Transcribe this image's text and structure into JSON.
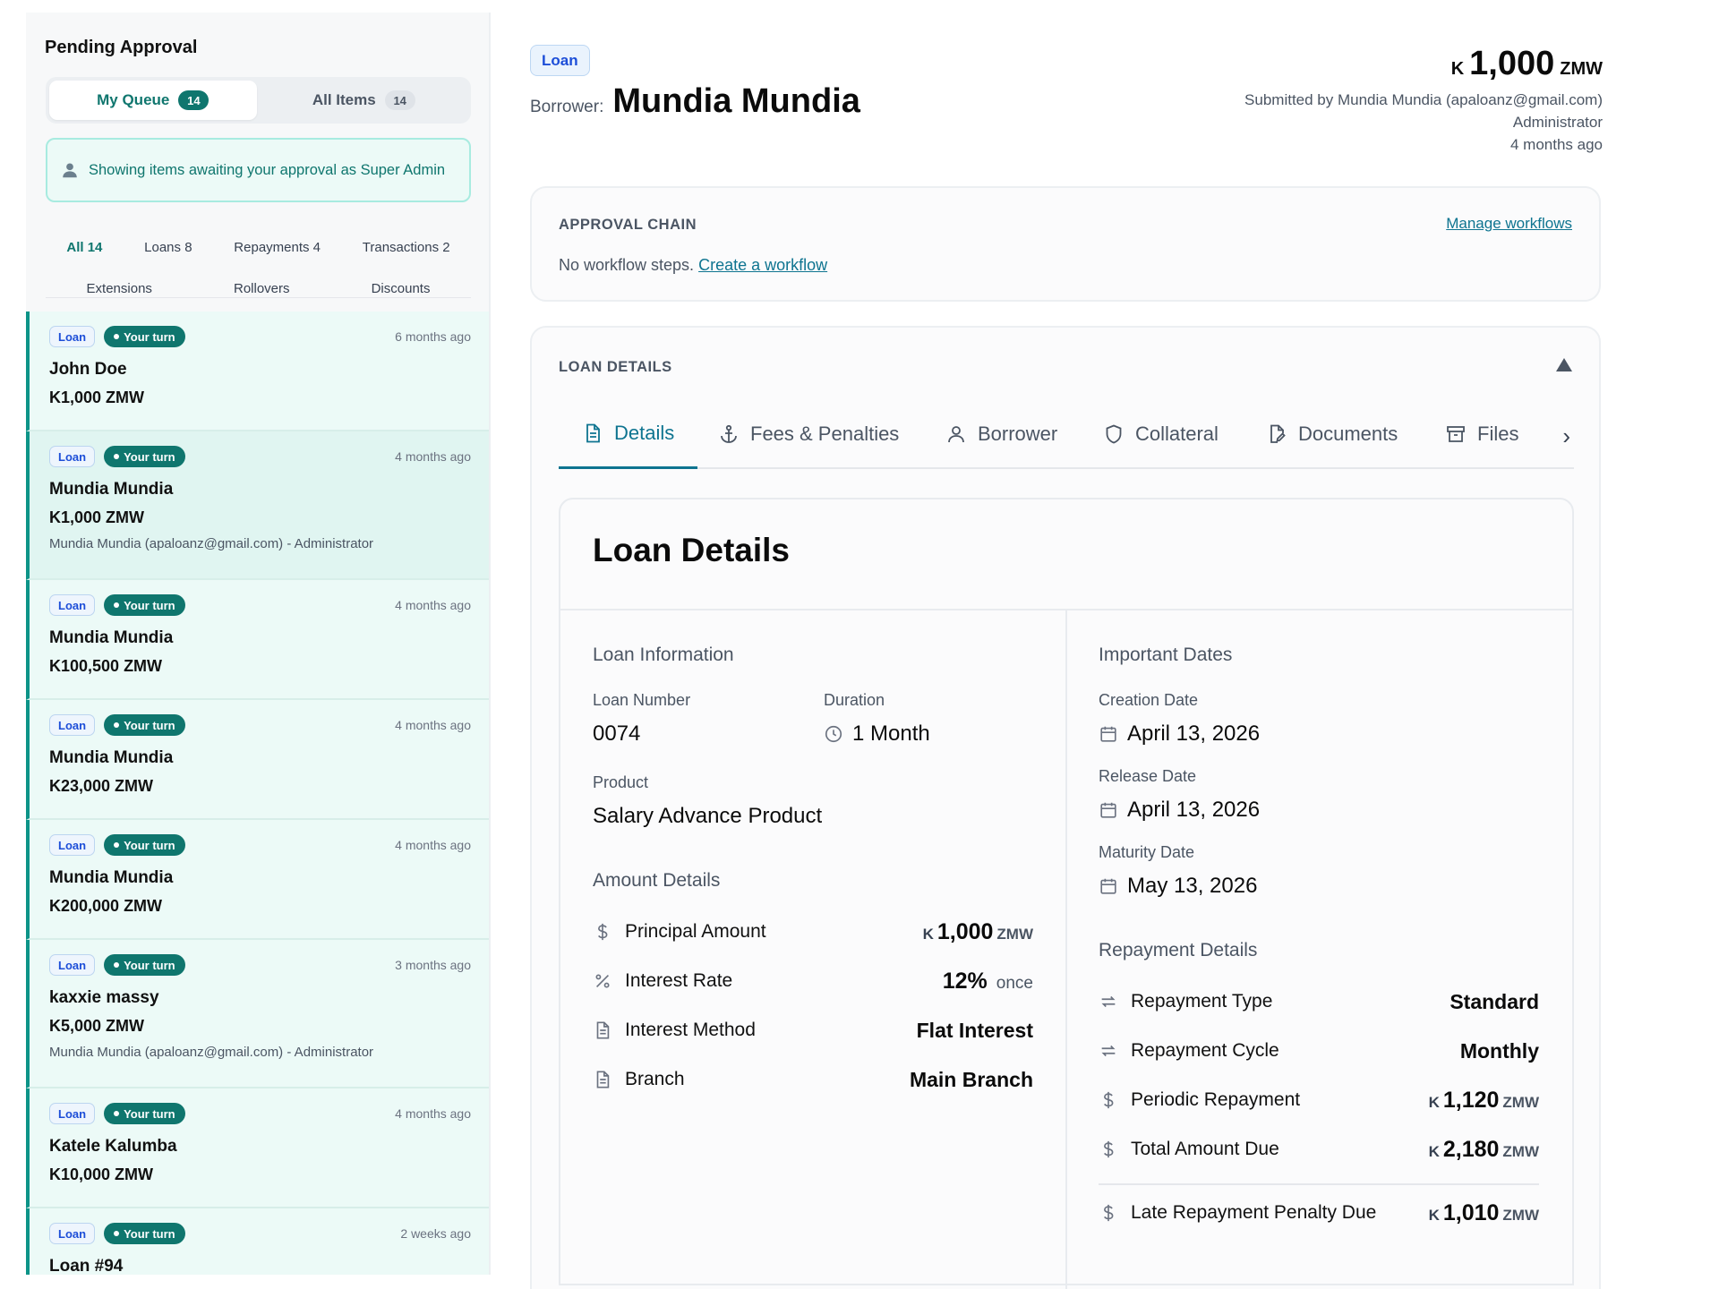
{
  "sidebar": {
    "title": "Pending Approval",
    "tabs": [
      {
        "label": "My Queue",
        "count": "14"
      },
      {
        "label": "All Items",
        "count": "14"
      }
    ],
    "info_text": "Showing items awaiting your approval as Super Admin",
    "filters_row1": [
      "All 14",
      "Loans 8",
      "Repayments 4",
      "Transactions 2"
    ],
    "filters_row2": [
      "Extensions",
      "Rollovers",
      "Discounts"
    ],
    "items": [
      {
        "type": "Loan",
        "status": "Your turn",
        "time": "6 months ago",
        "name": "John Doe",
        "amount": "K1,000 ZMW",
        "sub": ""
      },
      {
        "type": "Loan",
        "status": "Your turn",
        "time": "4 months ago",
        "name": "Mundia Mundia",
        "amount": "K1,000 ZMW",
        "sub": "Mundia Mundia (apaloanz@gmail.com) - Administrator"
      },
      {
        "type": "Loan",
        "status": "Your turn",
        "time": "4 months ago",
        "name": "Mundia Mundia",
        "amount": "K100,500 ZMW",
        "sub": ""
      },
      {
        "type": "Loan",
        "status": "Your turn",
        "time": "4 months ago",
        "name": "Mundia Mundia",
        "amount": "K23,000 ZMW",
        "sub": ""
      },
      {
        "type": "Loan",
        "status": "Your turn",
        "time": "4 months ago",
        "name": "Mundia Mundia",
        "amount": "K200,000 ZMW",
        "sub": ""
      },
      {
        "type": "Loan",
        "status": "Your turn",
        "time": "3 months ago",
        "name": "kaxxie massy",
        "amount": "K5,000 ZMW",
        "sub": "Mundia Mundia (apaloanz@gmail.com) - Administrator"
      },
      {
        "type": "Loan",
        "status": "Your turn",
        "time": "4 months ago",
        "name": "Katele Kalumba",
        "amount": "K10,000 ZMW",
        "sub": ""
      },
      {
        "type": "Loan",
        "status": "Your turn",
        "time": "2 weeks ago",
        "name": "Loan #94",
        "amount": "",
        "sub": ""
      }
    ]
  },
  "header": {
    "type_badge": "Loan",
    "borrower_label": "Borrower:",
    "borrower_name": "Mundia Mundia",
    "amount_symbol": "K",
    "amount_value": "1,000",
    "amount_currency": "ZMW",
    "submitted_by": "Submitted by Mundia Mundia (apaloanz@gmail.com)",
    "role": "Administrator",
    "time": "4 months ago"
  },
  "approval_chain": {
    "title": "APPROVAL CHAIN",
    "manage_link": "Manage workflows",
    "no_steps": "No workflow steps.",
    "create_link": "Create a workflow"
  },
  "loan_details": {
    "title": "LOAN DETAILS",
    "tabs": [
      "Details",
      "Fees & Penalties",
      "Borrower",
      "Collateral",
      "Documents",
      "Files"
    ],
    "panel_title": "Loan Details",
    "loan_info": {
      "title": "Loan Information",
      "loan_number_label": "Loan Number",
      "loan_number": "0074",
      "duration_label": "Duration",
      "duration": "1 Month",
      "product_label": "Product",
      "product": "Salary Advance Product"
    },
    "amount_details": {
      "title": "Amount Details",
      "rows": [
        {
          "label": "Principal Amount",
          "symbol": "K",
          "value": "1,000",
          "unit": "ZMW"
        },
        {
          "label": "Interest Rate",
          "value": "12%",
          "suffix": "once"
        },
        {
          "label": "Interest Method",
          "value": "Flat Interest"
        },
        {
          "label": "Branch",
          "value": "Main Branch"
        }
      ]
    },
    "dates": {
      "title": "Important Dates",
      "creation_label": "Creation Date",
      "creation": "April 13, 2026",
      "release_label": "Release Date",
      "release": "April 13, 2026",
      "maturity_label": "Maturity Date",
      "maturity": "May 13, 2026"
    },
    "repayment": {
      "title": "Repayment Details",
      "type_label": "Repayment Type",
      "type": "Standard",
      "cycle_label": "Repayment Cycle",
      "cycle": "Monthly",
      "periodic_label": "Periodic Repayment",
      "periodic_symbol": "K",
      "periodic": "1,120",
      "periodic_unit": "ZMW",
      "total_label": "Total Amount Due",
      "total_symbol": "K",
      "total": "2,180",
      "total_unit": "ZMW",
      "penalty_label": "Late Repayment Penalty Due",
      "penalty_symbol": "K",
      "penalty": "1,010",
      "penalty_unit": "ZMW"
    }
  },
  "colors": {
    "accent": "#0f766e",
    "link": "#0e7490",
    "loan_badge": "#1d4ed8"
  }
}
